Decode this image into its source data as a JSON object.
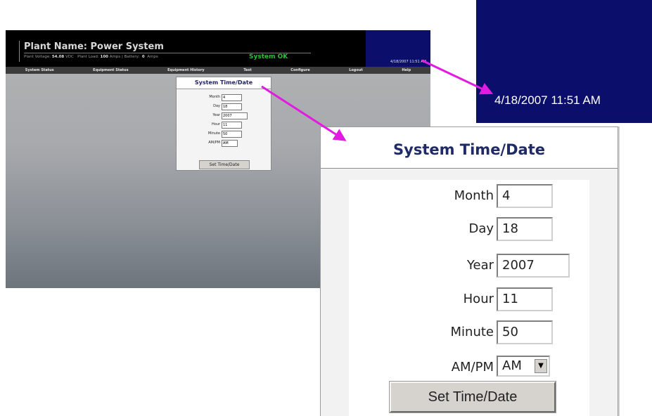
{
  "header": {
    "plant_name": "Plant Name:  Power System",
    "stats": {
      "voltage_label": "Plant Voltage:",
      "voltage_value": "54.08",
      "voltage_unit": "VDC",
      "load_label": "Plant Load:",
      "load_value": "100",
      "load_unit": "Amps",
      "battery_label": "Battery:",
      "battery_value": "0",
      "battery_unit": "Amps"
    },
    "system_status": "System OK",
    "clock_text": "4/18/2007 11:51 AM"
  },
  "nav": {
    "items": [
      "System Status",
      "Equipment Status",
      "Equipment History",
      "Test",
      "Configure",
      "Logout",
      "Help"
    ]
  },
  "dialog": {
    "title": "System Time/Date",
    "fields": {
      "month": {
        "label": "Month",
        "value": "4"
      },
      "day": {
        "label": "Day",
        "value": "18"
      },
      "year": {
        "label": "Year",
        "value": "2007"
      },
      "hour": {
        "label": "Hour",
        "value": "11"
      },
      "minute": {
        "label": "Minute",
        "value": "50"
      },
      "ampm": {
        "label": "AM/PM",
        "value": "AM"
      }
    },
    "submit_label": "Set Time/Date"
  },
  "zoom_clock_text": "4/18/2007 11:51 AM",
  "colors": {
    "header_bg": "#000000",
    "clock_bg": "#0b0f6b",
    "status_ok": "#2fbf3a",
    "callout_arrow": "#e21be2"
  }
}
